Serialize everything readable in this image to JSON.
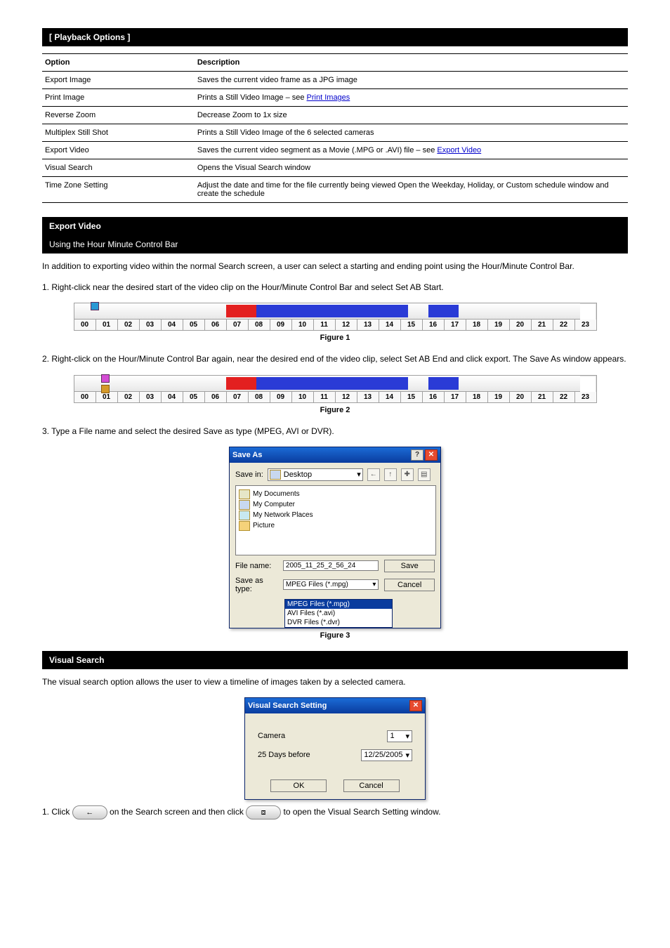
{
  "header": {
    "title_bar": "[ Playback Options ]"
  },
  "options_table": {
    "headers": [
      "Option",
      "Description"
    ],
    "rows": [
      {
        "opt": "Export Image",
        "desc": "Saves the current video frame as a JPG image"
      },
      {
        "opt": "Print Image",
        "desc": "Prints a Still Video Image – see ",
        "link": "Print Images",
        "link_href": "#"
      },
      {
        "opt": "Reverse Zoom",
        "desc": "Decrease Zoom to 1x size"
      },
      {
        "opt": "Multiplex Still Shot",
        "desc": "Prints a Still Video Image of the 6 selected cameras"
      },
      {
        "opt": "Export Video",
        "desc": "Saves the current video segment as a Movie (.MPG or .AVI) file – see ",
        "link": "Export Video",
        "link_href": "#"
      },
      {
        "opt": "Visual Search",
        "desc": "Opens the Visual Search window"
      },
      {
        "opt": "Time Zone Setting",
        "desc": "Adjust the date and time for the file currently being viewed Open the Weekday, Holiday, or Custom schedule window and create the schedule"
      }
    ]
  },
  "export_section": {
    "para_1_1": "In addition to exporting video within the normal Search screen, a user can select a starting and ending point using the Hour/Minute Control Bar.",
    "para_1_2": "1. Right-click near the desired start of the video clip on the Hour/Minute Control Bar and select Set AB Start.",
    "fig1_caption": "Figure 1",
    "para_1_3": "2. Right-click on the Hour/Minute Control Bar again, near the desired end of the video clip, select Set AB End and click export. The Save As window appears.",
    "fig2_caption": "Figure 2",
    "para_1_4": "3. Type a File name and select the desired Save as type (MPEG, AVI or DVR)."
  },
  "timeline": {
    "hours": [
      "00",
      "01",
      "02",
      "03",
      "04",
      "05",
      "06",
      "07",
      "08",
      "09",
      "10",
      "11",
      "12",
      "13",
      "14",
      "15",
      "16",
      "17",
      "18",
      "19",
      "20",
      "21",
      "22",
      "23"
    ],
    "fig1": {
      "marker_single_pos_pct": 3,
      "red": {
        "left_pct": 30,
        "width_pct": 6
      },
      "blue1": {
        "left_pct": 36,
        "width_pct": 30
      },
      "blue2": {
        "left_pct": 70,
        "width_pct": 6
      }
    },
    "fig2": {
      "marker_double_pos_pct": 5,
      "red": {
        "left_pct": 30,
        "width_pct": 6
      },
      "blue1": {
        "left_pct": 36,
        "width_pct": 30
      },
      "blue2": {
        "left_pct": 70,
        "width_pct": 6
      }
    }
  },
  "save_as": {
    "title": "Save As",
    "save_in_label": "Save in:",
    "save_in_value": "Desktop",
    "file_list": [
      "My Documents",
      "My Computer",
      "My Network Places",
      "Picture"
    ],
    "file_name_label": "File name:",
    "file_name_value": "2005_11_25_2_56_24",
    "save_as_type_label": "Save as type:",
    "save_as_type_value": "MPEG Files (*.mpg)",
    "type_options": [
      "MPEG Files (*.mpg)",
      "AVI Files (*.avi)",
      "DVR Files (*.dvr)"
    ],
    "save_btn": "Save",
    "cancel_btn": "Cancel",
    "caption": "Figure 3"
  },
  "visual_search": {
    "title": "Visual Search Setting",
    "camera_label": "Camera",
    "camera_value": "1",
    "days_before_label": "25 Days before",
    "date_value": "12/25/2005",
    "ok": "OK",
    "cancel": "Cancel"
  },
  "vs_section": {
    "para_1": "The visual search option allows the user to view a timeline of images taken by a selected camera.",
    "para_2_prefix": "1. Click ",
    "para_2_mid": " on the Search screen and then click ",
    "para_2_suffix": " to open the Visual Search Setting window."
  },
  "icons": {
    "help": "?",
    "close": "✕",
    "back": "←",
    "dropdown": "▾",
    "up": "↑",
    "newfolder": "✚",
    "viewmenu": "▤",
    "desktop": "▣",
    "arrow_left": "←",
    "clock": "⧈"
  }
}
